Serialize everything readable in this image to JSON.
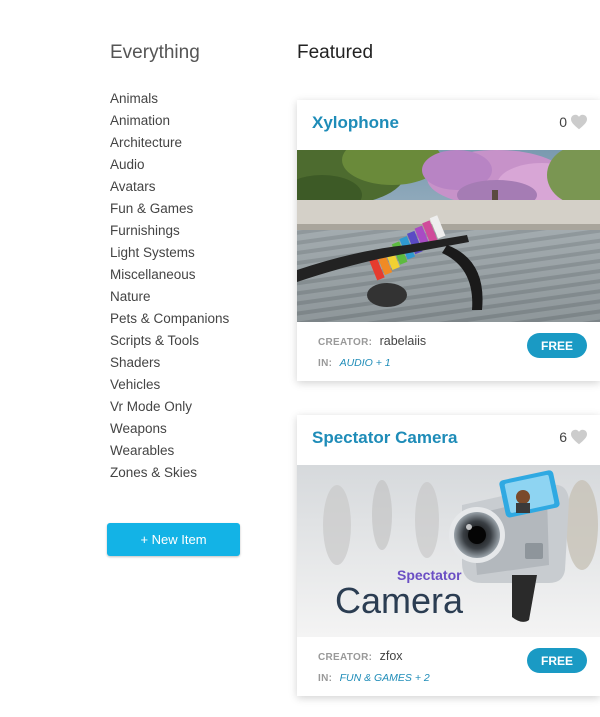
{
  "sidebar": {
    "heading": "Everything",
    "categories": [
      "Animals",
      "Animation",
      "Architecture",
      "Audio",
      "Avatars",
      "Fun & Games",
      "Furnishings",
      "Light Systems",
      "Miscellaneous",
      "Nature",
      "Pets & Companions",
      "Scripts & Tools",
      "Shaders",
      "Vehicles",
      "Vr Mode Only",
      "Weapons",
      "Wearables",
      "Zones & Skies"
    ],
    "new_item_label": "+ New Item"
  },
  "featured": {
    "heading": "Featured",
    "items": [
      {
        "title": "Xylophone",
        "likes": "0",
        "creator_label": "CREATOR:",
        "creator": "rabelaiis",
        "in_label": "IN:",
        "categories": "AUDIO + 1",
        "price_label": "FREE"
      },
      {
        "title": "Spectator Camera",
        "likes": "6",
        "creator_label": "CREATOR:",
        "creator": "zfox",
        "in_label": "IN:",
        "categories": "FUN & GAMES + 2",
        "price_label": "FREE",
        "image_text_small": "Spectator",
        "image_text_large": "Camera"
      }
    ]
  },
  "colors": {
    "accent_link": "#1e8cb8",
    "new_button": "#13b3e6",
    "free_button": "#1a9ac4",
    "heart": "#cccccc"
  },
  "icons": {
    "like": "heart-icon"
  }
}
